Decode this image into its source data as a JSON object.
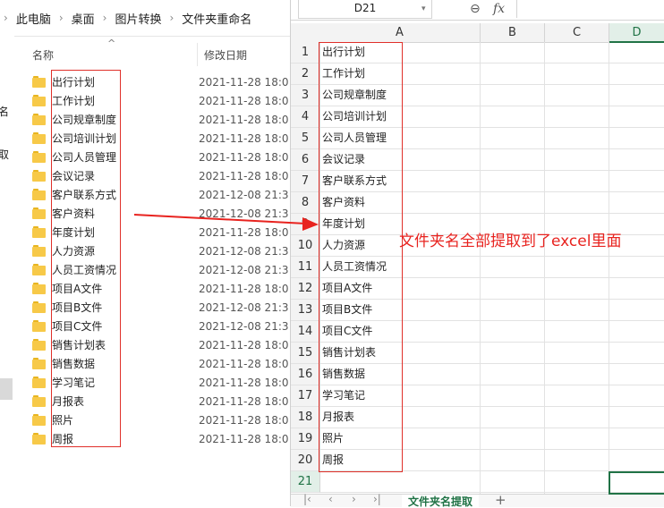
{
  "explorer": {
    "breadcrumb": [
      "此电脑",
      "桌面",
      "图片转换",
      "文件夹重命名"
    ],
    "left_nav": [
      "名",
      "取"
    ],
    "columns": {
      "name": "名称",
      "modified": "修改日期"
    },
    "folders": [
      {
        "name": "出行计划",
        "date": "2021-11-28 18:0"
      },
      {
        "name": "工作计划",
        "date": "2021-11-28 18:0"
      },
      {
        "name": "公司规章制度",
        "date": "2021-11-28 18:0"
      },
      {
        "name": "公司培训计划",
        "date": "2021-11-28 18:0"
      },
      {
        "name": "公司人员管理",
        "date": "2021-11-28 18:0"
      },
      {
        "name": "会议记录",
        "date": "2021-11-28 18:0"
      },
      {
        "name": "客户联系方式",
        "date": "2021-12-08 21:3"
      },
      {
        "name": "客户资料",
        "date": "2021-12-08 21:3"
      },
      {
        "name": "年度计划",
        "date": "2021-11-28 18:0"
      },
      {
        "name": "人力资源",
        "date": "2021-12-08 21:3"
      },
      {
        "name": "人员工资情况",
        "date": "2021-12-08 21:3"
      },
      {
        "name": "项目A文件",
        "date": "2021-11-28 18:0"
      },
      {
        "name": "项目B文件",
        "date": "2021-12-08 21:3"
      },
      {
        "name": "项目C文件",
        "date": "2021-12-08 21:3"
      },
      {
        "name": "销售计划表",
        "date": "2021-11-28 18:0"
      },
      {
        "name": "销售数据",
        "date": "2021-11-28 18:0"
      },
      {
        "name": "学习笔记",
        "date": "2021-11-28 18:0"
      },
      {
        "name": "月报表",
        "date": "2021-11-28 18:0"
      },
      {
        "name": "照片",
        "date": "2021-11-28 18:0"
      },
      {
        "name": "周报",
        "date": "2021-11-28 18:0"
      }
    ]
  },
  "sheet": {
    "name_box": "D21",
    "fx_label": "fx",
    "columns": [
      "A",
      "B",
      "C",
      "D"
    ],
    "selected_column": "D",
    "rows": [
      "1",
      "2",
      "3",
      "4",
      "5",
      "6",
      "7",
      "8",
      "9",
      "10",
      "11",
      "12",
      "13",
      "14",
      "15",
      "16",
      "17",
      "18",
      "19",
      "20",
      "21"
    ],
    "selected_row": "21",
    "cells_a": [
      "出行计划",
      "工作计划",
      "公司规章制度",
      "公司培训计划",
      "公司人员管理",
      "会议记录",
      "客户联系方式",
      "客户资料",
      "年度计划",
      "人力资源",
      "人员工资情况",
      "项目A文件",
      "项目B文件",
      "项目C文件",
      "销售计划表",
      "销售数据",
      "学习笔记",
      "月报表",
      "照片",
      "周报"
    ],
    "sheet_tab": "文件夹名提取",
    "add_tab": "+"
  },
  "annotation": {
    "text": "文件夹名全部提取到了excel里面",
    "color": "#e8231f"
  },
  "colors": {
    "accent": "#217346",
    "red_box": "#e0302a",
    "folder": "#f7c948"
  }
}
